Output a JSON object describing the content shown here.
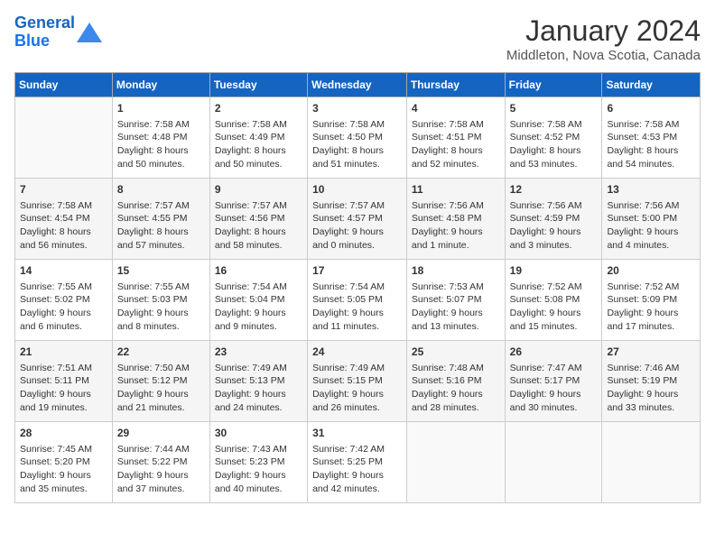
{
  "header": {
    "logo_line1": "General",
    "logo_line2": "Blue",
    "main_title": "January 2024",
    "subtitle": "Middleton, Nova Scotia, Canada"
  },
  "calendar": {
    "days_of_week": [
      "Sunday",
      "Monday",
      "Tuesday",
      "Wednesday",
      "Thursday",
      "Friday",
      "Saturday"
    ],
    "weeks": [
      [
        {
          "day": "",
          "sunrise": "",
          "sunset": "",
          "daylight": ""
        },
        {
          "day": "1",
          "sunrise": "Sunrise: 7:58 AM",
          "sunset": "Sunset: 4:48 PM",
          "daylight": "Daylight: 8 hours and 50 minutes."
        },
        {
          "day": "2",
          "sunrise": "Sunrise: 7:58 AM",
          "sunset": "Sunset: 4:49 PM",
          "daylight": "Daylight: 8 hours and 50 minutes."
        },
        {
          "day": "3",
          "sunrise": "Sunrise: 7:58 AM",
          "sunset": "Sunset: 4:50 PM",
          "daylight": "Daylight: 8 hours and 51 minutes."
        },
        {
          "day": "4",
          "sunrise": "Sunrise: 7:58 AM",
          "sunset": "Sunset: 4:51 PM",
          "daylight": "Daylight: 8 hours and 52 minutes."
        },
        {
          "day": "5",
          "sunrise": "Sunrise: 7:58 AM",
          "sunset": "Sunset: 4:52 PM",
          "daylight": "Daylight: 8 hours and 53 minutes."
        },
        {
          "day": "6",
          "sunrise": "Sunrise: 7:58 AM",
          "sunset": "Sunset: 4:53 PM",
          "daylight": "Daylight: 8 hours and 54 minutes."
        }
      ],
      [
        {
          "day": "7",
          "sunrise": "Sunrise: 7:58 AM",
          "sunset": "Sunset: 4:54 PM",
          "daylight": "Daylight: 8 hours and 56 minutes."
        },
        {
          "day": "8",
          "sunrise": "Sunrise: 7:57 AM",
          "sunset": "Sunset: 4:55 PM",
          "daylight": "Daylight: 8 hours and 57 minutes."
        },
        {
          "day": "9",
          "sunrise": "Sunrise: 7:57 AM",
          "sunset": "Sunset: 4:56 PM",
          "daylight": "Daylight: 8 hours and 58 minutes."
        },
        {
          "day": "10",
          "sunrise": "Sunrise: 7:57 AM",
          "sunset": "Sunset: 4:57 PM",
          "daylight": "Daylight: 9 hours and 0 minutes."
        },
        {
          "day": "11",
          "sunrise": "Sunrise: 7:56 AM",
          "sunset": "Sunset: 4:58 PM",
          "daylight": "Daylight: 9 hours and 1 minute."
        },
        {
          "day": "12",
          "sunrise": "Sunrise: 7:56 AM",
          "sunset": "Sunset: 4:59 PM",
          "daylight": "Daylight: 9 hours and 3 minutes."
        },
        {
          "day": "13",
          "sunrise": "Sunrise: 7:56 AM",
          "sunset": "Sunset: 5:00 PM",
          "daylight": "Daylight: 9 hours and 4 minutes."
        }
      ],
      [
        {
          "day": "14",
          "sunrise": "Sunrise: 7:55 AM",
          "sunset": "Sunset: 5:02 PM",
          "daylight": "Daylight: 9 hours and 6 minutes."
        },
        {
          "day": "15",
          "sunrise": "Sunrise: 7:55 AM",
          "sunset": "Sunset: 5:03 PM",
          "daylight": "Daylight: 9 hours and 8 minutes."
        },
        {
          "day": "16",
          "sunrise": "Sunrise: 7:54 AM",
          "sunset": "Sunset: 5:04 PM",
          "daylight": "Daylight: 9 hours and 9 minutes."
        },
        {
          "day": "17",
          "sunrise": "Sunrise: 7:54 AM",
          "sunset": "Sunset: 5:05 PM",
          "daylight": "Daylight: 9 hours and 11 minutes."
        },
        {
          "day": "18",
          "sunrise": "Sunrise: 7:53 AM",
          "sunset": "Sunset: 5:07 PM",
          "daylight": "Daylight: 9 hours and 13 minutes."
        },
        {
          "day": "19",
          "sunrise": "Sunrise: 7:52 AM",
          "sunset": "Sunset: 5:08 PM",
          "daylight": "Daylight: 9 hours and 15 minutes."
        },
        {
          "day": "20",
          "sunrise": "Sunrise: 7:52 AM",
          "sunset": "Sunset: 5:09 PM",
          "daylight": "Daylight: 9 hours and 17 minutes."
        }
      ],
      [
        {
          "day": "21",
          "sunrise": "Sunrise: 7:51 AM",
          "sunset": "Sunset: 5:11 PM",
          "daylight": "Daylight: 9 hours and 19 minutes."
        },
        {
          "day": "22",
          "sunrise": "Sunrise: 7:50 AM",
          "sunset": "Sunset: 5:12 PM",
          "daylight": "Daylight: 9 hours and 21 minutes."
        },
        {
          "day": "23",
          "sunrise": "Sunrise: 7:49 AM",
          "sunset": "Sunset: 5:13 PM",
          "daylight": "Daylight: 9 hours and 24 minutes."
        },
        {
          "day": "24",
          "sunrise": "Sunrise: 7:49 AM",
          "sunset": "Sunset: 5:15 PM",
          "daylight": "Daylight: 9 hours and 26 minutes."
        },
        {
          "day": "25",
          "sunrise": "Sunrise: 7:48 AM",
          "sunset": "Sunset: 5:16 PM",
          "daylight": "Daylight: 9 hours and 28 minutes."
        },
        {
          "day": "26",
          "sunrise": "Sunrise: 7:47 AM",
          "sunset": "Sunset: 5:17 PM",
          "daylight": "Daylight: 9 hours and 30 minutes."
        },
        {
          "day": "27",
          "sunrise": "Sunrise: 7:46 AM",
          "sunset": "Sunset: 5:19 PM",
          "daylight": "Daylight: 9 hours and 33 minutes."
        }
      ],
      [
        {
          "day": "28",
          "sunrise": "Sunrise: 7:45 AM",
          "sunset": "Sunset: 5:20 PM",
          "daylight": "Daylight: 9 hours and 35 minutes."
        },
        {
          "day": "29",
          "sunrise": "Sunrise: 7:44 AM",
          "sunset": "Sunset: 5:22 PM",
          "daylight": "Daylight: 9 hours and 37 minutes."
        },
        {
          "day": "30",
          "sunrise": "Sunrise: 7:43 AM",
          "sunset": "Sunset: 5:23 PM",
          "daylight": "Daylight: 9 hours and 40 minutes."
        },
        {
          "day": "31",
          "sunrise": "Sunrise: 7:42 AM",
          "sunset": "Sunset: 5:25 PM",
          "daylight": "Daylight: 9 hours and 42 minutes."
        },
        {
          "day": "",
          "sunrise": "",
          "sunset": "",
          "daylight": ""
        },
        {
          "day": "",
          "sunrise": "",
          "sunset": "",
          "daylight": ""
        },
        {
          "day": "",
          "sunrise": "",
          "sunset": "",
          "daylight": ""
        }
      ]
    ]
  }
}
